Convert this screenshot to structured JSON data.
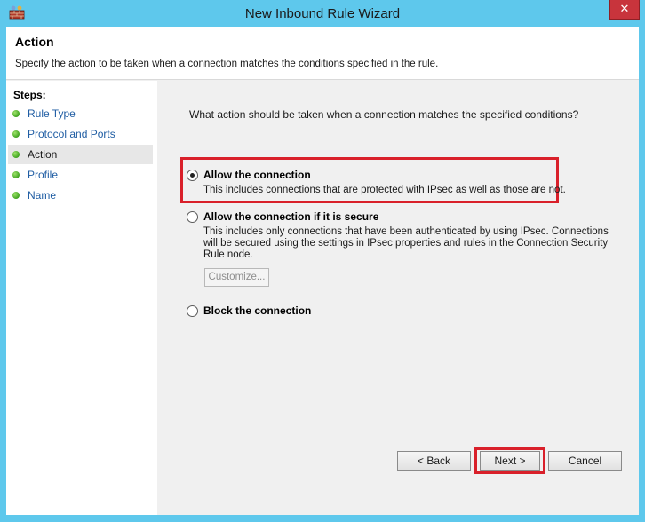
{
  "window": {
    "title": "New Inbound Rule Wizard",
    "close_label": "✕"
  },
  "header": {
    "title": "Action",
    "description": "Specify the action to be taken when a connection matches the conditions specified in the rule."
  },
  "steps": {
    "heading": "Steps:",
    "items": [
      {
        "label": "Rule Type"
      },
      {
        "label": "Protocol and Ports"
      },
      {
        "label": "Action"
      },
      {
        "label": "Profile"
      },
      {
        "label": "Name"
      }
    ],
    "current": "Action"
  },
  "main": {
    "question": "What action should be taken when a connection matches the specified conditions?",
    "options": [
      {
        "title": "Allow the connection",
        "description": "This includes connections that are protected with IPsec as well as those are not.",
        "selected": true
      },
      {
        "title": "Allow the connection if it is secure",
        "description_lines": [
          "This includes only connections that have been authenticated by using IPsec.  Connections",
          "will be secured using the settings in IPsec properties and rules in the Connection Security",
          "Rule node."
        ],
        "selected": false
      },
      {
        "title": "Block the connection",
        "selected": false
      }
    ],
    "customize_label": "Customize..."
  },
  "buttons": {
    "back": "< Back",
    "next": "Next >",
    "cancel": "Cancel"
  },
  "colors": {
    "title_bar": "#5ec8ec",
    "highlight": "#d9202a",
    "step_link": "#1f5da3",
    "step_dot": "#3fa31f"
  }
}
